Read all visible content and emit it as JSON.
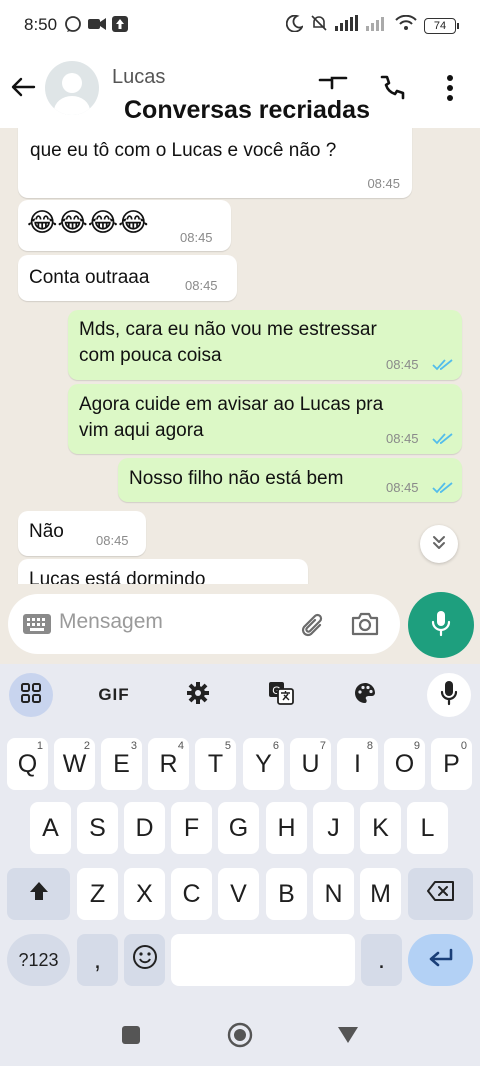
{
  "status_bar": {
    "time": "8:50",
    "battery": "74"
  },
  "header": {
    "contact_name": "Lucas",
    "caption": "Conversas recriadas"
  },
  "messages": [
    {
      "text": "que eu tô com o Lucas e você não ?",
      "time": "08:45",
      "direction": "in"
    },
    {
      "text": "😂😂😂😂",
      "time": "08:45",
      "direction": "in"
    },
    {
      "text": "Conta outraaa",
      "time": "08:45",
      "direction": "in"
    },
    {
      "line1": "Mds, cara eu não vou me estressar",
      "line2": "com pouca coisa",
      "time": "08:45",
      "direction": "out"
    },
    {
      "line1": "Agora cuide em avisar ao Lucas pra",
      "line2": "vim aqui agora",
      "time": "08:45",
      "direction": "out"
    },
    {
      "text": "Nosso filho não está bem",
      "time": "08:45",
      "direction": "out"
    },
    {
      "text": "Não",
      "time": "08:45",
      "direction": "in"
    },
    {
      "text": "Lucas está dormindo",
      "direction": "in"
    }
  ],
  "composer": {
    "placeholder": "Mensagem"
  },
  "keyboard": {
    "toolbar": {
      "gif_label": "GIF"
    },
    "row1": [
      {
        "k": "Q",
        "h": "1"
      },
      {
        "k": "W",
        "h": "2"
      },
      {
        "k": "E",
        "h": "3"
      },
      {
        "k": "R",
        "h": "4"
      },
      {
        "k": "T",
        "h": "5"
      },
      {
        "k": "Y",
        "h": "6"
      },
      {
        "k": "U",
        "h": "7"
      },
      {
        "k": "I",
        "h": "8"
      },
      {
        "k": "O",
        "h": "9"
      },
      {
        "k": "P",
        "h": "0"
      }
    ],
    "row2": [
      "A",
      "S",
      "D",
      "F",
      "G",
      "H",
      "J",
      "K",
      "L"
    ],
    "row3": [
      "Z",
      "X",
      "C",
      "V",
      "B",
      "N",
      "M"
    ],
    "symbols_label": "?123",
    "comma": ",",
    "period": "."
  },
  "colors": {
    "outgoing_bubble": "#dcf8c6",
    "chat_background": "#efeae2",
    "accent": "#1e9f7e",
    "read_ticks": "#53bdeb"
  }
}
